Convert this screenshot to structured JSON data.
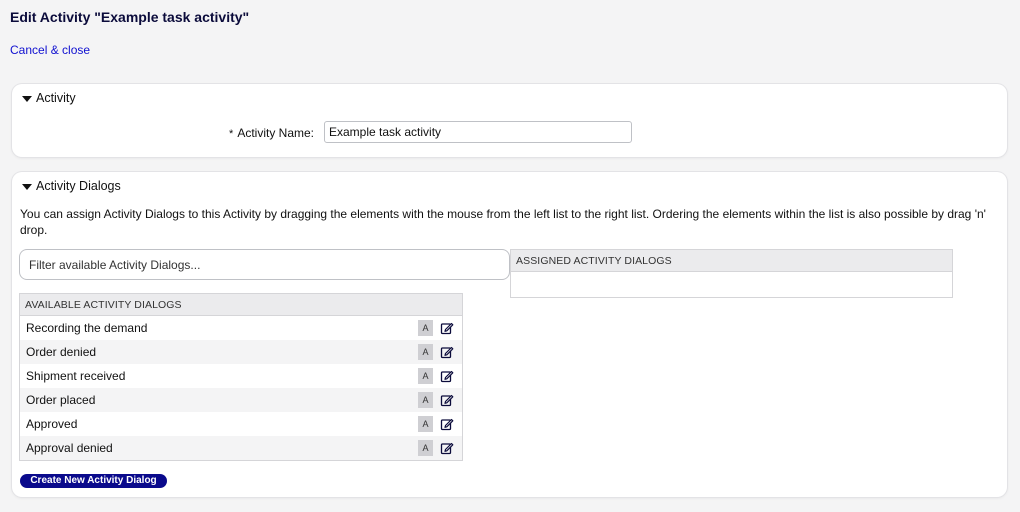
{
  "page": {
    "title": "Edit Activity \"Example task activity\"",
    "cancel_link": "Cancel & close"
  },
  "activity_section": {
    "header": "Activity",
    "required_mark": "*",
    "name_label": "Activity Name:",
    "name_value": "Example task activity"
  },
  "dialogs_section": {
    "header": "Activity Dialogs",
    "description": "You can assign Activity Dialogs to this Activity by dragging the elements with the mouse from the left list to the right list. Ordering the elements within the list is also possible by drag 'n' drop.",
    "filter_placeholder": "Filter available Activity Dialogs...",
    "assigned_header": "ASSIGNED ACTIVITY DIALOGS",
    "available_header": "AVAILABLE ACTIVITY DIALOGS",
    "available_items": [
      {
        "label": "Recording the demand",
        "badge": "A"
      },
      {
        "label": "Order denied",
        "badge": "A"
      },
      {
        "label": "Shipment received",
        "badge": "A"
      },
      {
        "label": "Order placed",
        "badge": "A"
      },
      {
        "label": "Approved",
        "badge": "A"
      },
      {
        "label": "Approval denied",
        "badge": "A"
      }
    ],
    "create_button": "Create New Activity Dialog"
  },
  "colors": {
    "primary_button": "#0a0a8c",
    "link": "#1010d0",
    "background": "#f4f4f5"
  }
}
